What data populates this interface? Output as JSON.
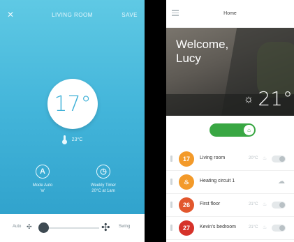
{
  "left_screen": {
    "header": {
      "close_icon": "close-icon",
      "title": "LIVING ROOM",
      "save_label": "SAVE"
    },
    "setpoint": "17°",
    "current_temp": "23°C",
    "mode": {
      "icon": "auto-mode-icon",
      "icon_glyph": "A",
      "label": "Mode Auto",
      "sub": "'w'"
    },
    "weekly_timer": {
      "icon": "timer-icon",
      "label": "Weekly Timer",
      "sub": "20°C at 1am"
    },
    "fan": {
      "auto_label": "Auto",
      "swing_label": "Swing",
      "small_fan_icon": "fan-small-icon",
      "large_fan_icon": "fan-large-icon"
    },
    "colors": {
      "gradient_top": "#5fc9e4",
      "gradient_bottom": "#2c9ec9"
    }
  },
  "right_screen": {
    "header": {
      "title": "Home",
      "menu_icon": "hamburger-menu-icon"
    },
    "welcome": "Welcome,",
    "user": "Lucy",
    "weather": {
      "icon": "partly-cloudy-icon",
      "temp": "21°"
    },
    "power_toggle": {
      "state": "on",
      "icon": "home-icon",
      "color": "#39a743"
    },
    "rooms": [
      {
        "badge": "17",
        "color": "#f39a2a",
        "name": "Living room",
        "target": "20°C"
      },
      {
        "badge": "♨",
        "color": "#f39a2a",
        "name": "Heating circuit 1",
        "target": ""
      },
      {
        "badge": "26",
        "color": "#e2572d",
        "name": "First floor",
        "target": "21°C"
      },
      {
        "badge": "27",
        "color": "#d6322a",
        "name": "Kevin's bedroom",
        "target": "21°C"
      }
    ]
  }
}
